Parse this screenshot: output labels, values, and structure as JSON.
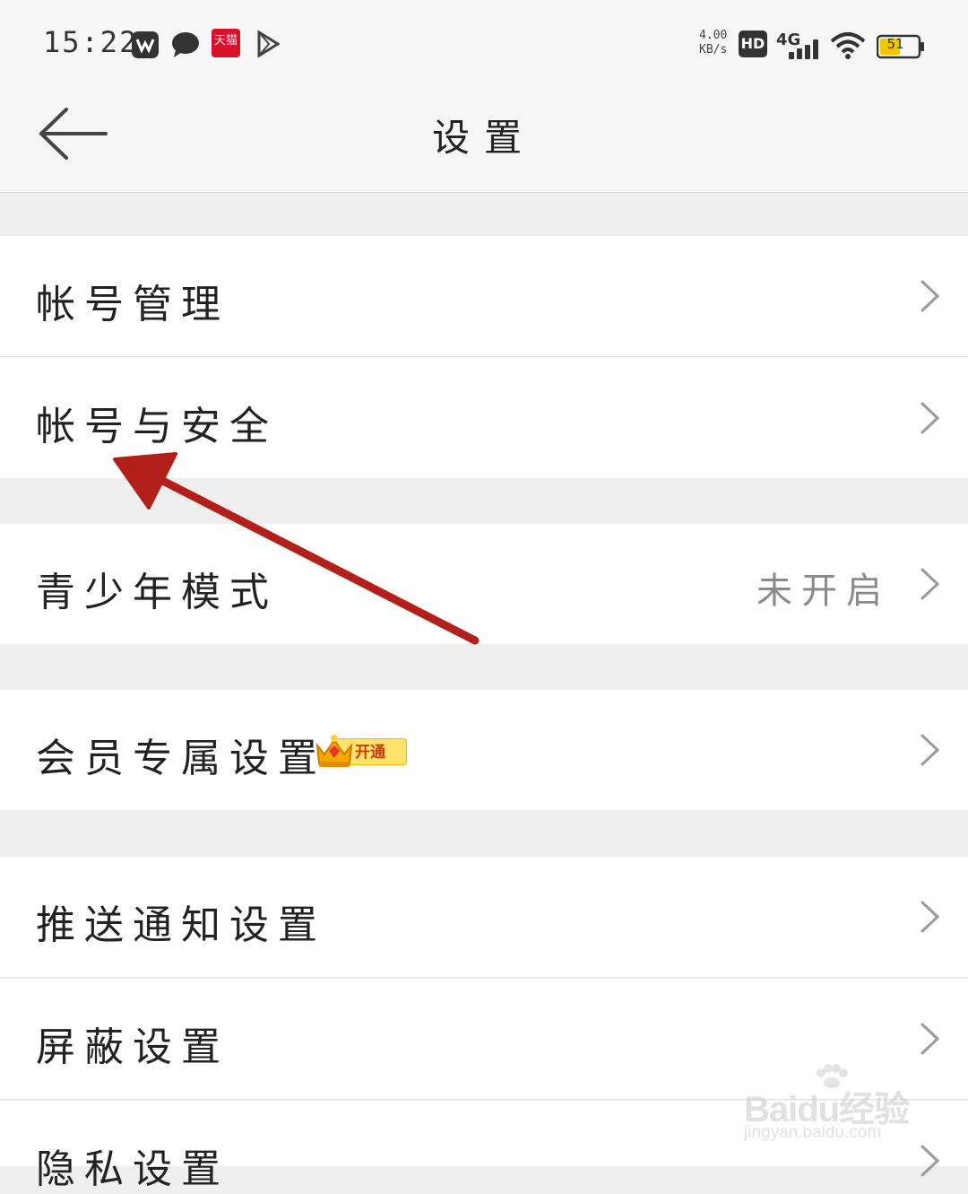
{
  "status_bar": {
    "time": "15:22",
    "tmall_label": "天猫",
    "speed_value": "4.00",
    "speed_unit": "KB/s",
    "hd_label": "HD",
    "network": "4G",
    "battery_percent": "51",
    "icons": [
      "app-icon",
      "message-icon",
      "tmall-icon",
      "play-icon",
      "hd-icon",
      "signal-icon",
      "wifi-icon",
      "battery-icon"
    ]
  },
  "header": {
    "title": "设置",
    "back_icon": "back-arrow-icon"
  },
  "rows": [
    {
      "label": "帐号管理"
    },
    {
      "label": "帐号与安全"
    },
    {
      "label": "青少年模式",
      "value": "未开启"
    },
    {
      "label": "会员专属设置",
      "badge": "开通"
    },
    {
      "label": "推送通知设置"
    },
    {
      "label": "屏蔽设置"
    },
    {
      "label": "隐私设置"
    }
  ],
  "watermark": {
    "brand": "Baidu经验",
    "url": "jingyan.baidu.com"
  },
  "colors": {
    "background": "#efefef",
    "row": "#ffffff",
    "annotation_arrow": "#b3201a",
    "value_text": "#8a8a8a"
  }
}
